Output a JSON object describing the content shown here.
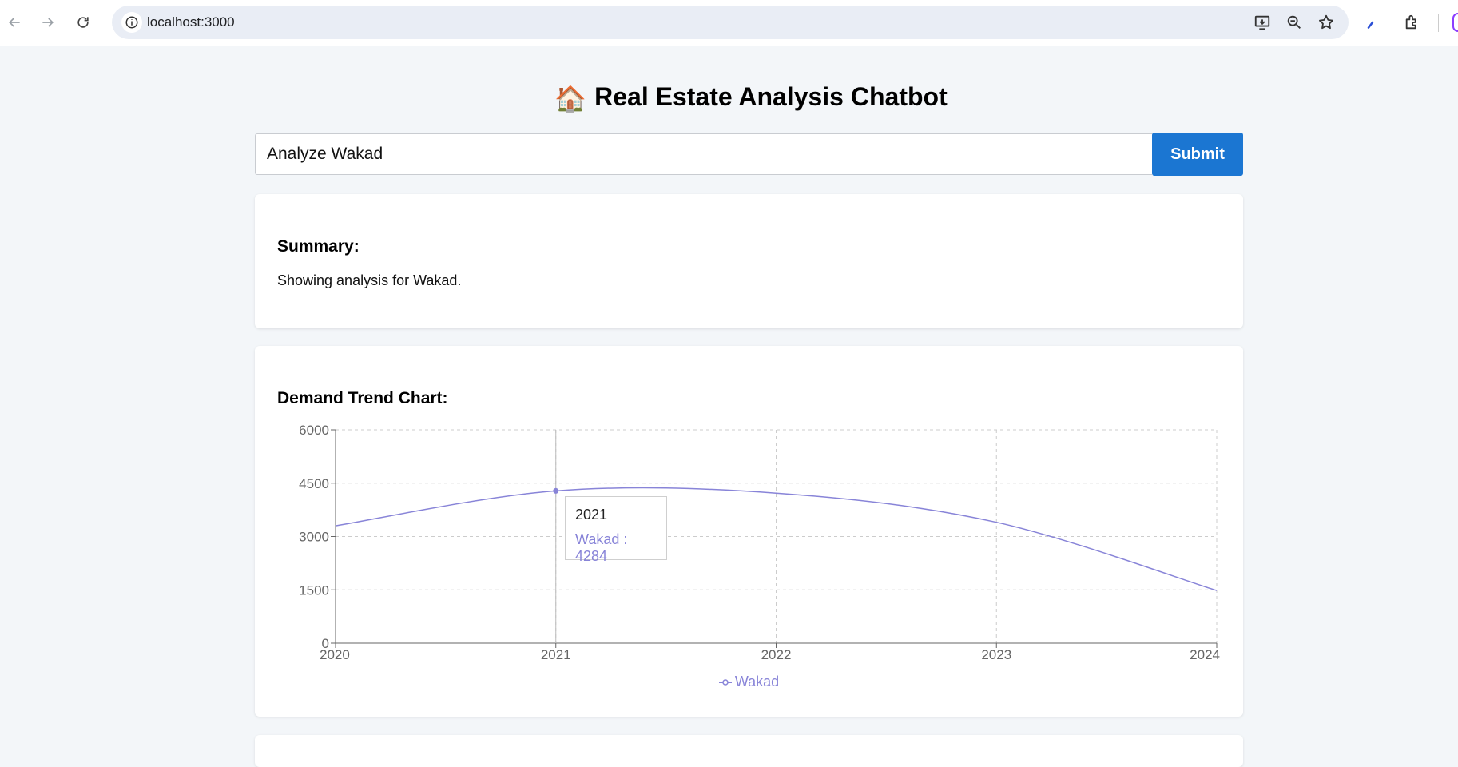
{
  "browser": {
    "url": "localhost:3000"
  },
  "app": {
    "title_emoji": "🏠",
    "title": "Real Estate Analysis Chatbot"
  },
  "query": {
    "value": "Analyze Wakad",
    "submit_label": "Submit"
  },
  "summary": {
    "heading": "Summary:",
    "text": "Showing analysis for Wakad."
  },
  "chart_section": {
    "heading": "Demand Trend Chart:"
  },
  "chart_data": {
    "type": "line",
    "title": "",
    "xlabel": "",
    "ylabel": "",
    "x": [
      "2020",
      "2021",
      "2022",
      "2023",
      "2024"
    ],
    "series": [
      {
        "name": "Wakad",
        "values": [
          3300,
          4284,
          4220,
          3400,
          1480
        ],
        "color": "#8884d8"
      }
    ],
    "ylim": [
      0,
      6000
    ],
    "yticks": [
      "0",
      "1500",
      "3000",
      "4500",
      "6000"
    ],
    "grid": true,
    "legend": "bottom-center",
    "tooltip": {
      "label": "2021",
      "text": "Wakad : 4284"
    }
  }
}
